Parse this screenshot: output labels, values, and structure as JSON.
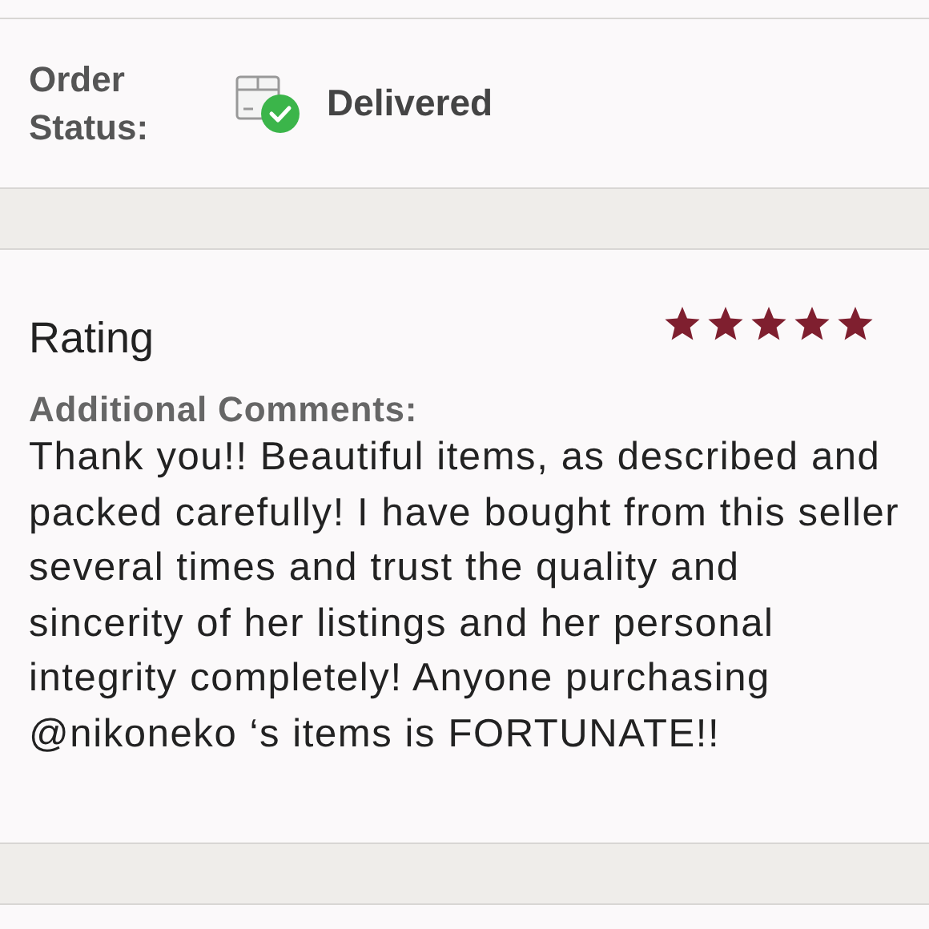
{
  "order": {
    "label": "Order Status:",
    "status": "Delivered",
    "delivered": true
  },
  "rating": {
    "title": "Rating",
    "stars": 5,
    "comments_label": "Additional Comments:",
    "comment": "Thank you!! Beautiful items, as described and packed carefully! I have bought from this seller several times and trust the quality and sincerity of her listings and her personal integrity completely! Anyone purchasing @nikoneko ‘s items is FORTUNATE!!"
  }
}
